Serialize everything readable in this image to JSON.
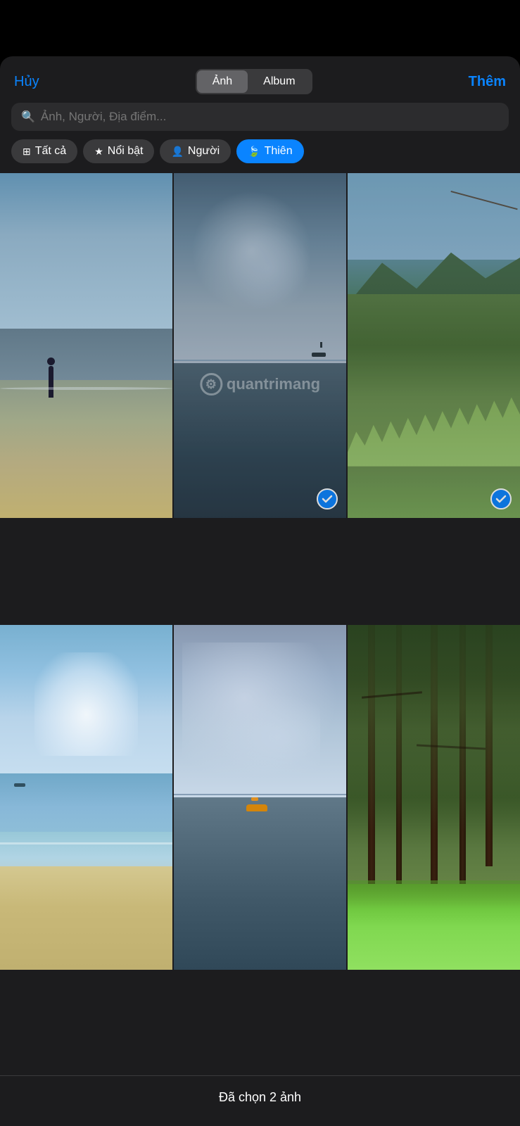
{
  "header": {
    "cancel_label": "Hủy",
    "add_label": "Thêm",
    "segment": {
      "photo_label": "Ảnh",
      "album_label": "Album",
      "active": "photo"
    }
  },
  "search": {
    "placeholder": "Ảnh, Người, Địa điểm..."
  },
  "filter_tabs": [
    {
      "id": "all",
      "label": "Tất cả",
      "icon": "grid",
      "active": false
    },
    {
      "id": "featured",
      "label": "Nổi bật",
      "icon": "star",
      "active": false
    },
    {
      "id": "people",
      "label": "Người",
      "icon": "person",
      "active": false
    },
    {
      "id": "nature",
      "label": "Thiên",
      "icon": "leaf",
      "active": true
    }
  ],
  "photos": [
    {
      "id": 1,
      "type": "beach-person",
      "selected": false,
      "col": 1,
      "row": 1
    },
    {
      "id": 2,
      "type": "sea-clouds",
      "selected": true,
      "col": 2,
      "row": 1
    },
    {
      "id": 3,
      "type": "green-mountain",
      "selected": true,
      "col": 3,
      "row": 1
    },
    {
      "id": 4,
      "type": "beach-shore",
      "selected": false,
      "col": 1,
      "row": 2
    },
    {
      "id": 5,
      "type": "sea-boat",
      "selected": false,
      "col": 2,
      "row": 2
    },
    {
      "id": 6,
      "type": "pine-forest",
      "selected": false,
      "col": 3,
      "row": 2
    }
  ],
  "watermark": {
    "icon": "⚙",
    "text": "quantrimang"
  },
  "bottom_bar": {
    "text": "Đã chọn 2 ảnh"
  }
}
